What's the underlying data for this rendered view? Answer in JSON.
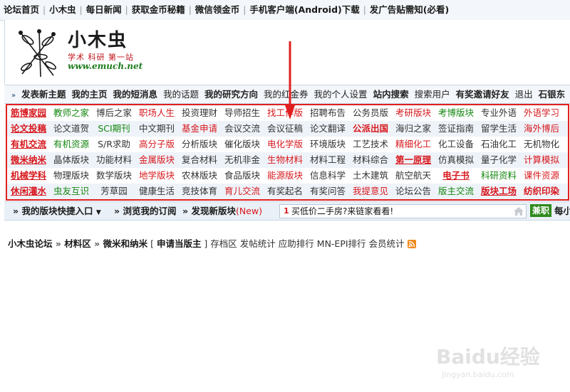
{
  "topnav": {
    "items": [
      "论坛首页",
      "小木虫",
      "每日新闻",
      "获取金币秘籍",
      "微信领金币",
      "手机客户端(Android)下载",
      "发广告贴需知(必看)"
    ]
  },
  "logo": {
    "name": "小木虫",
    "slogan": "学术 科研 第一站",
    "url": "www.emuch.net"
  },
  "menubar": {
    "items": [
      {
        "label": "发表新主题",
        "bold": true
      },
      {
        "label": "我的主页",
        "bold": true
      },
      {
        "label": "我的短消息",
        "bold": true
      },
      {
        "label": "我的话题",
        "bold": false
      },
      {
        "label": "我的研究方向",
        "bold": true
      },
      {
        "label": "我的红金券",
        "bold": false
      },
      {
        "label": "我的个人设置",
        "bold": false
      },
      {
        "label": "站内搜索",
        "bold": true
      },
      {
        "label": "搜索用户",
        "bold": false
      },
      {
        "label": "有奖邀请好友",
        "bold": true
      },
      {
        "label": "退出",
        "bold": false
      },
      {
        "label": "石银东",
        "bold": true
      }
    ]
  },
  "forum_grid": {
    "rows": [
      [
        {
          "label": "筋博家园",
          "color": "red",
          "bold": true,
          "underline": true
        },
        {
          "label": "教师之家",
          "color": "green"
        },
        {
          "label": "博后之家",
          "color": "dark"
        },
        {
          "label": "职场人生",
          "color": "red"
        },
        {
          "label": "投资理财",
          "color": "dark"
        },
        {
          "label": "导师招生",
          "color": "dark"
        },
        {
          "label": "找工作版",
          "color": "red"
        },
        {
          "label": "招聘布告",
          "color": "dark"
        },
        {
          "label": "公务员版",
          "color": "dark"
        },
        {
          "label": "考研版块",
          "color": "red"
        },
        {
          "label": "考博版块",
          "color": "green"
        },
        {
          "label": "专业外语",
          "color": "dark"
        },
        {
          "label": "外语学习",
          "color": "red"
        }
      ],
      [
        {
          "label": "论文投稿",
          "color": "red",
          "bold": true,
          "underline": true
        },
        {
          "label": "论文道贺",
          "color": "dark"
        },
        {
          "label": "SCI期刊",
          "color": "green"
        },
        {
          "label": "中文期刊",
          "color": "dark"
        },
        {
          "label": "基金申请",
          "color": "red"
        },
        {
          "label": "会议交流",
          "color": "dark"
        },
        {
          "label": "会议征稿",
          "color": "dark"
        },
        {
          "label": "论文翻译",
          "color": "dark"
        },
        {
          "label": "公派出国",
          "color": "red",
          "bold": true
        },
        {
          "label": "海归之家",
          "color": "dark"
        },
        {
          "label": "签证指南",
          "color": "dark"
        },
        {
          "label": "留学生活",
          "color": "dark"
        },
        {
          "label": "海外博后",
          "color": "red"
        }
      ],
      [
        {
          "label": "有机交流",
          "color": "red",
          "bold": true,
          "underline": true
        },
        {
          "label": "有机资源",
          "color": "green"
        },
        {
          "label": "S/R求助",
          "color": "dark"
        },
        {
          "label": "高分子版",
          "color": "red"
        },
        {
          "label": "分析版块",
          "color": "dark"
        },
        {
          "label": "催化版块",
          "color": "dark"
        },
        {
          "label": "电化学版",
          "color": "red"
        },
        {
          "label": "环境版块",
          "color": "dark"
        },
        {
          "label": "工艺技术",
          "color": "dark"
        },
        {
          "label": "精细化工",
          "color": "red"
        },
        {
          "label": "化工设备",
          "color": "dark"
        },
        {
          "label": "石油化工",
          "color": "dark"
        },
        {
          "label": "无机物化",
          "color": "dark"
        }
      ],
      [
        {
          "label": "微米纳米",
          "color": "red",
          "bold": true,
          "underline": true
        },
        {
          "label": "晶体版块",
          "color": "dark"
        },
        {
          "label": "功能材料",
          "color": "dark"
        },
        {
          "label": "金属版块",
          "color": "red"
        },
        {
          "label": "复合材料",
          "color": "dark"
        },
        {
          "label": "无机非金",
          "color": "dark"
        },
        {
          "label": "生物材料",
          "color": "red"
        },
        {
          "label": "材料工程",
          "color": "dark"
        },
        {
          "label": "材料综合",
          "color": "dark"
        },
        {
          "label": "第一原理",
          "color": "red",
          "bold": true,
          "underline": true
        },
        {
          "label": "仿真模拟",
          "color": "dark"
        },
        {
          "label": "量子化学",
          "color": "dark"
        },
        {
          "label": "计算模拟",
          "color": "red"
        }
      ],
      [
        {
          "label": "机械学科",
          "color": "red",
          "bold": true,
          "underline": true
        },
        {
          "label": "物理版块",
          "color": "dark"
        },
        {
          "label": "数学版块",
          "color": "dark"
        },
        {
          "label": "地学版块",
          "color": "red"
        },
        {
          "label": "农林版块",
          "color": "dark"
        },
        {
          "label": "食品版块",
          "color": "dark"
        },
        {
          "label": "能源版块",
          "color": "red"
        },
        {
          "label": "信息科学",
          "color": "dark"
        },
        {
          "label": "土木建筑",
          "color": "dark"
        },
        {
          "label": "航空航天",
          "color": "dark"
        },
        {
          "label": "电子书",
          "color": "red",
          "bold": true,
          "underline": true
        },
        {
          "label": "科研资料",
          "color": "green"
        },
        {
          "label": "课件资源",
          "color": "red"
        }
      ],
      [
        {
          "label": "休闲灌水",
          "color": "red",
          "bold": true,
          "underline": true
        },
        {
          "label": "虫友互识",
          "color": "green"
        },
        {
          "label": "芳草园",
          "color": "dark"
        },
        {
          "label": "健康生活",
          "color": "dark"
        },
        {
          "label": "竞技体育",
          "color": "dark"
        },
        {
          "label": "育儿交流",
          "color": "red"
        },
        {
          "label": "有奖起名",
          "color": "dark"
        },
        {
          "label": "有奖问答",
          "color": "dark"
        },
        {
          "label": "我提意见",
          "color": "red"
        },
        {
          "label": "论坛公告",
          "color": "dark"
        },
        {
          "label": "版主交流",
          "color": "green"
        },
        {
          "label": "版块工场",
          "color": "red",
          "bold": true,
          "underline": true
        },
        {
          "label": "纺织印染",
          "color": "red",
          "bold": true
        }
      ]
    ]
  },
  "quickbar": {
    "quick_entry": "我的版块快捷入口",
    "browse_subscriptions": "浏览我的订阅",
    "discover_new": "发现新版块",
    "new_badge": "(New)",
    "ad_number": "1",
    "ad_text": "买低价二手房?来链家看看!",
    "jianzhi": "兼职",
    "mei": "每小"
  },
  "breadcrumb": {
    "site": "小木虫论坛",
    "section": "材料区",
    "forum": "微米和纳米",
    "apply": "申请当版主",
    "links": [
      "存档区",
      "发帖统计",
      "应助排行",
      "MN-EPI排行",
      "会员统计"
    ]
  },
  "watermark": {
    "brand": "Baidu经验",
    "url": "jingyan.baidu.com"
  },
  "colors": {
    "red": "#d7191e",
    "green": "#13860f",
    "dark": "#333333",
    "annotation": "#e02020"
  }
}
